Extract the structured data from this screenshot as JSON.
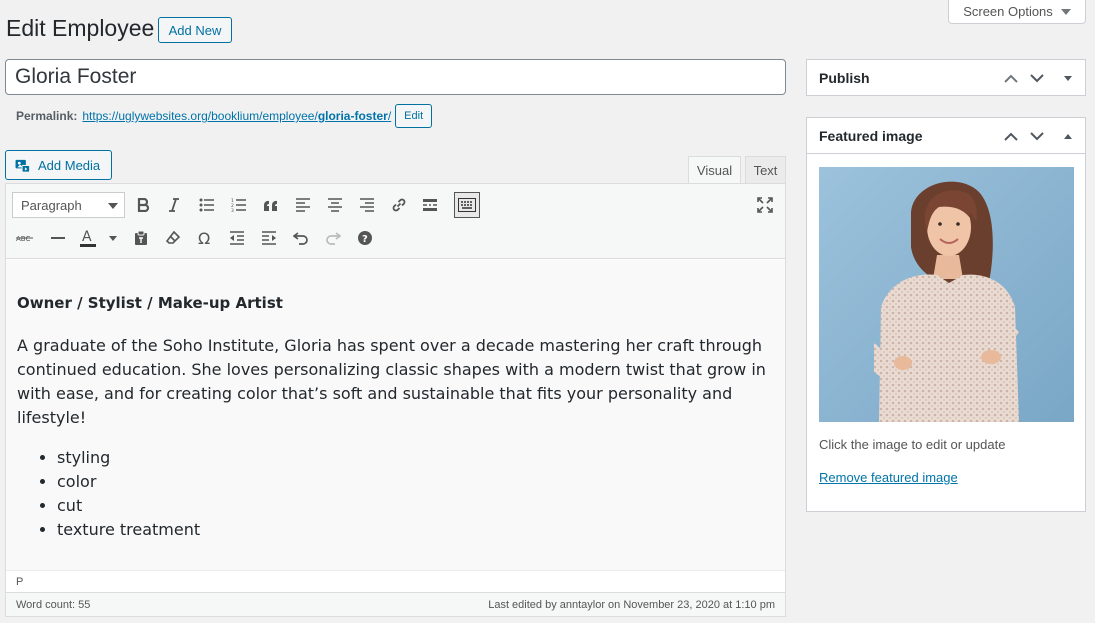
{
  "header": {
    "title": "Edit Employee",
    "add_new": "Add New",
    "screen_options": "Screen Options"
  },
  "post": {
    "title": "Gloria Foster"
  },
  "permalink": {
    "label": "Permalink:",
    "url_base": "https://uglywebsites.org/booklium/employee/",
    "slug": "gloria-foster",
    "url_suffix": "/",
    "edit_label": "Edit"
  },
  "editor": {
    "add_media": "Add Media",
    "tab_visual": "Visual",
    "tab_text": "Text",
    "format_value": "Paragraph",
    "heading": "Owner / Stylist / Make-up Artist",
    "paragraph": "A graduate of the Soho Institute, Gloria has spent over a decade mastering her craft through continued education. She loves personalizing classic shapes with a modern twist that grow in with ease, and for creating color that’s soft and sustainable that fits your personality and lifestyle!",
    "list": [
      "styling",
      "color",
      "cut",
      "texture treatment"
    ],
    "path": "P",
    "word_count": "Word count: 55",
    "last_edited": "Last edited by anntaylor on November 23, 2020 at 1:10 pm"
  },
  "toolbar_icons": {
    "row1": [
      "bold-icon",
      "italic-icon",
      "bulleted-list-icon",
      "numbered-list-icon",
      "blockquote-icon",
      "align-left-icon",
      "align-center-icon",
      "align-right-icon",
      "link-icon",
      "read-more-icon",
      "toolbar-toggle-icon",
      "fullscreen-icon"
    ],
    "row2": [
      "strikethrough-icon",
      "horizontal-line-icon",
      "text-color-icon",
      "paste-text-icon",
      "clear-formatting-icon",
      "special-character-icon",
      "outdent-icon",
      "indent-icon",
      "undo-icon",
      "redo-icon",
      "help-icon"
    ]
  },
  "sidebar": {
    "publish_title": "Publish",
    "featured_title": "Featured image",
    "featured_hint": "Click the image to edit or update",
    "remove_featured": "Remove featured image"
  },
  "colors": {
    "accent": "#0071a1",
    "link": "#0073aa",
    "background": "#f1f1f1",
    "photo_bg": "#8fb7d3"
  }
}
